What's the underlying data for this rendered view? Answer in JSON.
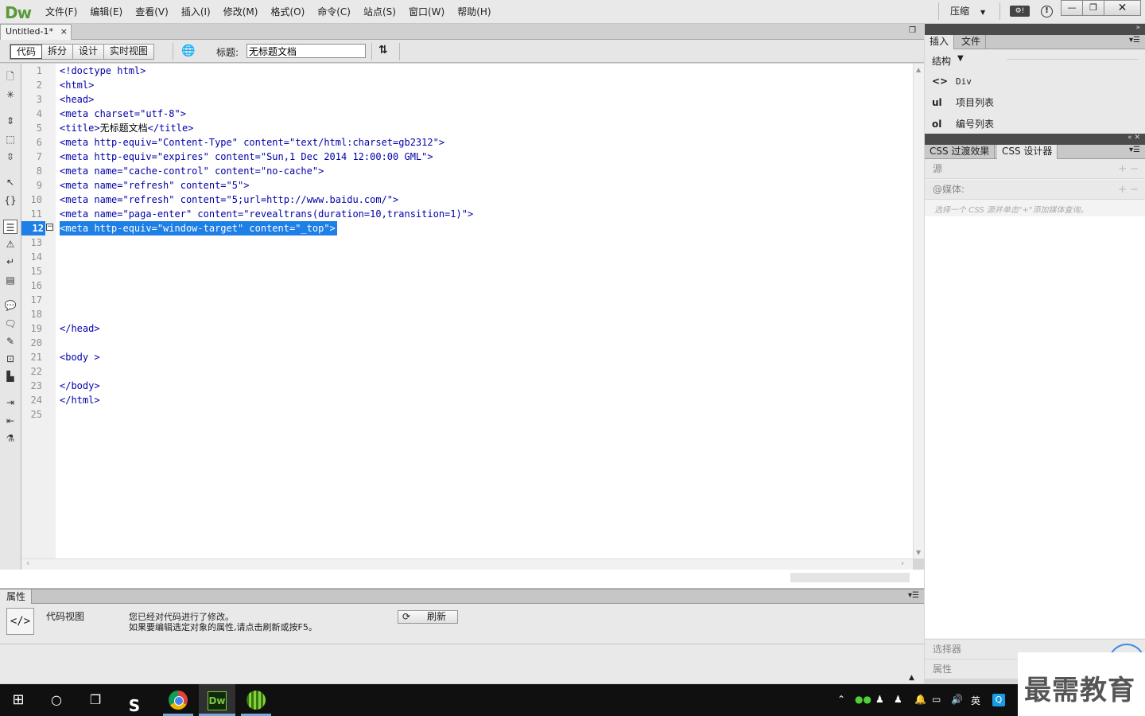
{
  "menubar": {
    "logo": "Dw",
    "items": [
      "文件(F)",
      "编辑(E)",
      "查看(V)",
      "插入(I)",
      "修改(M)",
      "格式(O)",
      "命令(C)",
      "站点(S)",
      "窗口(W)",
      "帮助(H)"
    ],
    "workspace": "压缩",
    "window_buttons": {
      "minimize": "—",
      "maximize": "❐",
      "close": "✕"
    }
  },
  "document": {
    "tab_title": "Untitled-1*",
    "tab_close": "×"
  },
  "doc_toolbar": {
    "view_tabs": [
      "代码",
      "拆分",
      "设计",
      "实时视图"
    ],
    "title_label": "标题:",
    "title_value": "无标题文档"
  },
  "editor": {
    "current_line": 12,
    "lines": [
      {
        "n": "1",
        "code": "<!doctype html>"
      },
      {
        "n": "2",
        "code": "<html>"
      },
      {
        "n": "3",
        "code": "<head>"
      },
      {
        "n": "4",
        "code": "<meta charset=\"utf-8\">"
      },
      {
        "n": "5",
        "code_pre": "<title>",
        "text": "无标题文档",
        "code_post": "</title>"
      },
      {
        "n": "6",
        "code": "<meta http-equiv=\"Content-Type\" content=\"text/html:charset=gb2312\">"
      },
      {
        "n": "7",
        "code": "<meta http-equiv=\"expires\" content=\"Sun,1 Dec 2014 12:00:00 GML\">"
      },
      {
        "n": "8",
        "code": "<meta name=\"cache-control\" content=\"no-cache\">"
      },
      {
        "n": "9",
        "code": "<meta name=\"refresh\" content=\"5\">"
      },
      {
        "n": "10",
        "code": "<meta name=\"refresh\" content=\"5;url=http://www.baidu.com/\">"
      },
      {
        "n": "11",
        "code": "<meta name=\"paga-enter\" content=\"revealtrans(duration=10,transition=1)\">"
      },
      {
        "n": "12",
        "code": "<meta http-equiv=\"window-target\" content=\"_top\">"
      },
      {
        "n": "13",
        "code": ""
      },
      {
        "n": "14",
        "code": ""
      },
      {
        "n": "15",
        "code": ""
      },
      {
        "n": "16",
        "code": ""
      },
      {
        "n": "17",
        "code": ""
      },
      {
        "n": "18",
        "code": ""
      },
      {
        "n": "19",
        "code": "</head>"
      },
      {
        "n": "20",
        "code": ""
      },
      {
        "n": "21",
        "code": "<body >"
      },
      {
        "n": "22",
        "code": ""
      },
      {
        "n": "23",
        "code": "</body>"
      },
      {
        "n": "24",
        "code": "</html>"
      },
      {
        "n": "25",
        "code": ""
      }
    ]
  },
  "properties": {
    "tab": "属性",
    "code_view_label": "代码视图",
    "message_line1": "您已经对代码进行了修改。",
    "message_line2": "如果要编辑选定对象的属性,请点击刷新或按F5。",
    "refresh_label": "刷新"
  },
  "right_panel": {
    "tabs_top": [
      "插入",
      "文件"
    ],
    "structure_label": "结构",
    "insert_items": [
      {
        "icon": "<>",
        "label": "Div"
      },
      {
        "icon": "ul",
        "label": "项目列表"
      },
      {
        "icon": "ol",
        "label": "编号列表"
      }
    ],
    "tabs_css": [
      "CSS 过渡效果",
      "CSS 设计器"
    ],
    "css_source": "源",
    "css_media": "@媒体:",
    "css_hint": "选择一个 CSS 源并单击\"+\"添加媒体查询。",
    "css_selector": "选择器",
    "css_properties": "属性"
  },
  "watermark": "最需教育",
  "taskbar": {
    "tray_lang": "英"
  }
}
